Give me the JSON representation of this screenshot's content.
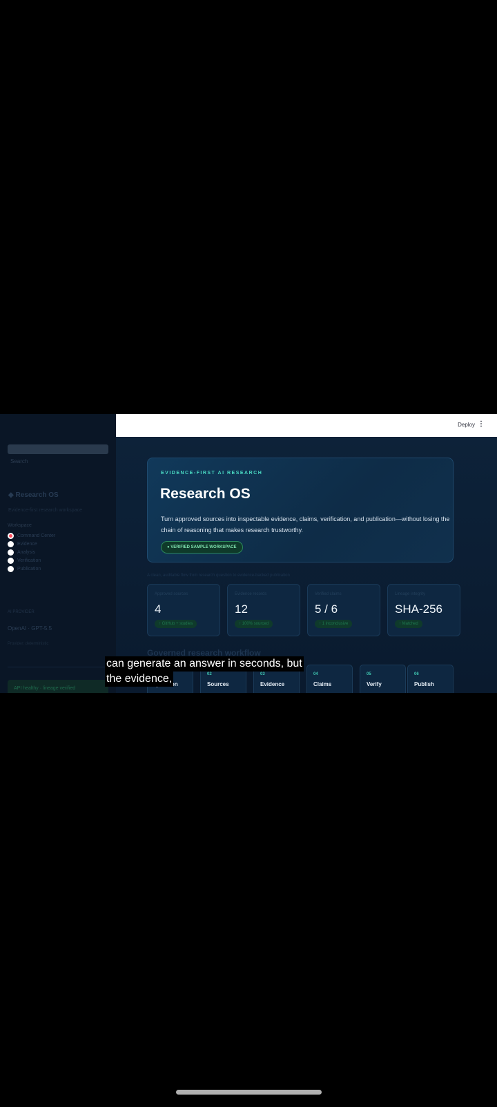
{
  "sidebar": {
    "search_hint": "Search",
    "brand": "◆ Research OS",
    "tagline": "Evidence-first research workspace",
    "section": "Workspace",
    "nav": [
      {
        "label": "Command Center",
        "selected": true
      },
      {
        "label": "Evidence",
        "selected": false
      },
      {
        "label": "Analysis",
        "selected": false
      },
      {
        "label": "Verification",
        "selected": false
      },
      {
        "label": "Publication",
        "selected": false
      }
    ],
    "model_label": "AI PROVIDER",
    "model": "OpenAI · GPT-5.5",
    "model_hint": "Provider: deterministic",
    "status": "API healthy · lineage verified"
  },
  "topbar": {
    "deploy": "Deploy",
    "menu_glyph": "⋮"
  },
  "hero": {
    "eyebrow": "EVIDENCE-FIRST AI RESEARCH",
    "title": "Research OS",
    "description": "Turn approved sources into inspectable evidence, claims, verification, and publication—without losing the chain of reasoning that makes research trustworthy.",
    "pill": "● VERIFIED SAMPLE WORKSPACE"
  },
  "caption_line": "A clean, auditable flow from research question to evidence-backed publication",
  "metrics": [
    {
      "label": "Approved sources",
      "value": "4",
      "badge": "↑ GitHub + studies"
    },
    {
      "label": "Evidence records",
      "value": "12",
      "badge": "↑ 100% sourced"
    },
    {
      "label": "Verified claims",
      "value": "5 / 6",
      "badge": "↑ 1 inconclusive"
    },
    {
      "label": "Lineage integrity",
      "value": "SHA-256",
      "badge": "↑ Matched"
    }
  ],
  "workflow_title": "Governed research workflow",
  "steps": [
    {
      "num": "01",
      "name": "Question"
    },
    {
      "num": "02",
      "name": "Sources"
    },
    {
      "num": "03",
      "name": "Evidence"
    },
    {
      "num": "04",
      "name": "Claims"
    },
    {
      "num": "05",
      "name": "Verify"
    },
    {
      "num": "06",
      "name": "Publish"
    }
  ],
  "subtitles": {
    "line1": "can generate an answer in seconds, but",
    "line2": "the evidence,"
  }
}
